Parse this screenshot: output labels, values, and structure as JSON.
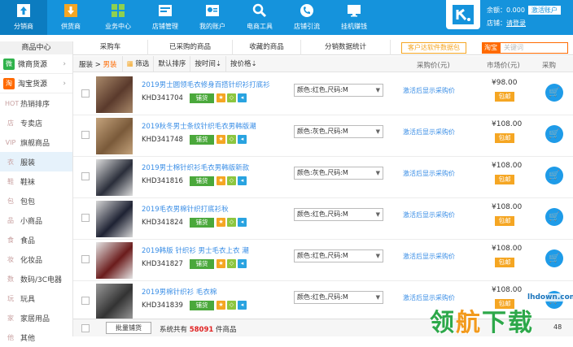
{
  "topnav": [
    {
      "label": "分销商",
      "icon": "upload-icon"
    },
    {
      "label": "供货商",
      "icon": "download-icon"
    },
    {
      "label": "业务中心",
      "icon": "grid-icon"
    },
    {
      "label": "店铺管理",
      "icon": "store-icon"
    },
    {
      "label": "我的账户",
      "icon": "account-card-icon"
    },
    {
      "label": "电商工具",
      "icon": "magnifier-icon"
    },
    {
      "label": "店铺引流",
      "icon": "phone-icon"
    },
    {
      "label": "挂机赚钱",
      "icon": "monitor-icon"
    }
  ],
  "account": {
    "balance_label": "余额：",
    "balance": "0.000",
    "topup": "激活账户",
    "store_label": "店铺：",
    "store_link": "请登录"
  },
  "sidebar": {
    "header": "商品中心",
    "sources": [
      {
        "label": "微商货源",
        "badge": "微",
        "color": "#2fb24b"
      },
      {
        "label": "淘宝货源",
        "badge": "淘",
        "color": "#ff6a00"
      }
    ],
    "items": [
      {
        "label": "热销排序",
        "icon": "HOT"
      },
      {
        "label": "专卖店",
        "icon": "店"
      },
      {
        "label": "旗舰商品",
        "icon": "VIP"
      },
      {
        "label": "服装",
        "icon": "衣"
      },
      {
        "label": "鞋袜",
        "icon": "鞋"
      },
      {
        "label": "包包",
        "icon": "包"
      },
      {
        "label": "小商品",
        "icon": "品"
      },
      {
        "label": "食品",
        "icon": "食"
      },
      {
        "label": "化妆品",
        "icon": "妆"
      },
      {
        "label": "数码/3C电器",
        "icon": "数"
      },
      {
        "label": "玩具",
        "icon": "玩"
      },
      {
        "label": "家居用品",
        "icon": "家"
      },
      {
        "label": "其他",
        "icon": "他"
      }
    ],
    "selected_index": 3
  },
  "tabs": [
    "采购车",
    "已采购的商品",
    "收藏的商品",
    "分销数据统计"
  ],
  "sync_button": "客户达软件数据包",
  "search": {
    "scope": "淘宝",
    "placeholder": "关键词"
  },
  "filters": {
    "crumb_root": "服装",
    "crumb_sep": " > ",
    "crumb_current": "男装",
    "filter": "筛选",
    "default_sort": "默认排序",
    "sort_time": "按时间",
    "sort_price": "按价格",
    "arrow": "⇣"
  },
  "columns": {
    "purchase_price": "采购价(元)",
    "market_price": "市场价(元)",
    "purchase": "采购"
  },
  "products": [
    {
      "name": "2019男士圆领毛衣修身百搭针织衫打底衫",
      "code": "KHD341704",
      "spec": "颜色:红色,尺码:M",
      "price": "¥98.00"
    },
    {
      "name": "2019秋冬男士条纹针织毛衣男韩版潮",
      "code": "KHD341748",
      "spec": "颜色:灰色,尺码:M",
      "price": "¥108.00"
    },
    {
      "name": "2019男士棉针织衫毛衣男韩版新款",
      "code": "KHD341816",
      "spec": "颜色:灰色,尺码:M",
      "price": "¥108.00"
    },
    {
      "name": "2019毛衣男棉针织打底衫秋",
      "code": "KHD341824",
      "spec": "颜色:红色,尺码:M",
      "price": "¥108.00"
    },
    {
      "name": "2019韩版 针织衫 男士毛衣上衣 潮",
      "code": "KHD341827",
      "spec": "颜色:红色,尺码:M",
      "price": "¥108.00"
    },
    {
      "name": "2019男棉针织衫 毛衣棉",
      "code": "KHD341839",
      "spec": "颜色:红色,尺码:M",
      "price": "¥108.00"
    }
  ],
  "row_labels": {
    "list_btn": "铺货",
    "vip_price": "激活后显示采购价",
    "ship": "包邮",
    "cart": "🛒"
  },
  "footer": {
    "batch": "批量铺货",
    "total_prefix": "系统共有",
    "total": "58091",
    "total_suffix": "件商品",
    "page": "48"
  },
  "watermark": {
    "url": "lhdown.com",
    "chars": [
      "领",
      "航",
      "下",
      "载"
    ]
  },
  "colors": {
    "primary": "#1593dc",
    "accent": "#ff6a00",
    "green": "#4aa83b",
    "link": "#3a8ee6"
  }
}
